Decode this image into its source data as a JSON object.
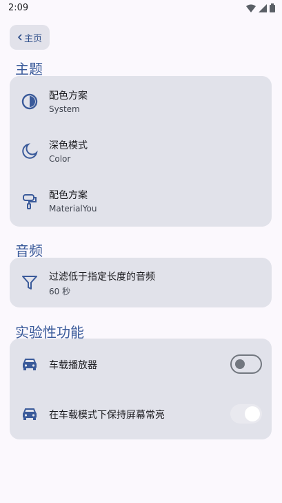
{
  "status": {
    "time": "2:09"
  },
  "back": {
    "label": "主页"
  },
  "sections": {
    "theme": {
      "title": "主题",
      "items": [
        {
          "title": "配色方案",
          "subtitle": "System",
          "icon": "contrast-icon"
        },
        {
          "title": "深色模式",
          "subtitle": "Color",
          "icon": "dark-mode-icon"
        },
        {
          "title": "配色方案",
          "subtitle": "MaterialYou",
          "icon": "paint-roller-icon"
        }
      ]
    },
    "audio": {
      "title": "音频",
      "items": [
        {
          "title": "过滤低于指定长度的音频",
          "subtitle": "60 秒",
          "icon": "filter-icon"
        }
      ]
    },
    "experimental": {
      "title": "实验性功能",
      "items": [
        {
          "title": "车载播放器",
          "icon": "car-icon",
          "switch": "off"
        },
        {
          "title": "在车载模式下保持屏幕常亮",
          "icon": "car-icon",
          "switch": "disabled-on"
        }
      ]
    }
  },
  "colors": {
    "accent": "#3a5a9a",
    "card": "#e1e2ea",
    "background": "#fbf8fd"
  }
}
